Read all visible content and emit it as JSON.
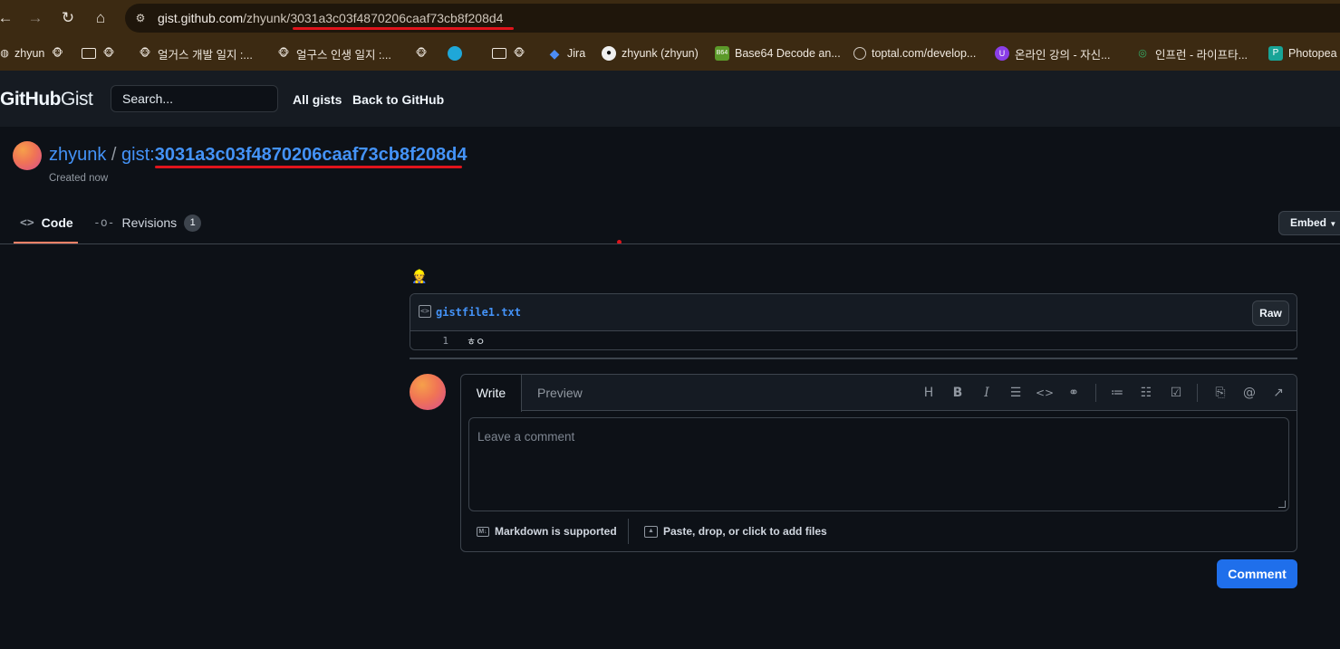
{
  "browser": {
    "url_host": "gist.github.com",
    "url_path_user": "/zhyunk/",
    "url_path_id": "3031a3c03f4870206caaf73cb8f208d4",
    "annotation_color": "#e0141c"
  },
  "bookmarks": [
    {
      "label": "zhyun",
      "icon": "monkey-icon"
    },
    {
      "label": "",
      "icon": "folder-icon"
    },
    {
      "label": "얼거스 개발 일지 :...",
      "icon": "monkey-icon"
    },
    {
      "label": "얼구스 인생 일지 :...",
      "icon": "monkey-icon"
    },
    {
      "label": "",
      "icon": "monkey-icon"
    },
    {
      "label": "",
      "icon": "edge-icon"
    },
    {
      "label": "",
      "icon": "folder-icon"
    },
    {
      "label": "Jira",
      "icon": "jira-icon"
    },
    {
      "label": "zhyunk (zhyun)",
      "icon": "github-icon"
    },
    {
      "label": "Base64 Decode an...",
      "icon": "base64-icon"
    },
    {
      "label": "toptal.com/develop...",
      "icon": "globe-icon"
    },
    {
      "label": "온라인 강의 - 자신...",
      "icon": "class-icon"
    },
    {
      "label": "인프런 - 라이프타...",
      "icon": "inflearn-icon"
    },
    {
      "label": "Photopea",
      "icon": "photopea-icon"
    }
  ],
  "header": {
    "logo_bold": "GitHub",
    "logo_light": "Gist",
    "search_placeholder": "Search...",
    "all_gists": "All gists",
    "back_to_github": "Back to GitHub"
  },
  "gist": {
    "owner": "zhyunk",
    "separator": " / ",
    "prefix": "gist:",
    "id": "3031a3c03f4870206caaf73cb8f208d4",
    "created": "Created now"
  },
  "tabs": {
    "code": "Code",
    "revisions": "Revisions",
    "revisions_count": "1",
    "embed": "Embed"
  },
  "file": {
    "name": "gistfile1.txt",
    "raw": "Raw",
    "line_number": "1",
    "line_content": "ㅎㅇ"
  },
  "comment": {
    "write_tab": "Write",
    "preview_tab": "Preview",
    "placeholder": "Leave a comment",
    "markdown_note": "Markdown is supported",
    "files_note": "Paste, drop, or click to add files",
    "submit": "Comment"
  },
  "colors": {
    "accent_link": "#4493f8",
    "primary_button": "#1f6feb",
    "tab_underline": "#f78166"
  }
}
